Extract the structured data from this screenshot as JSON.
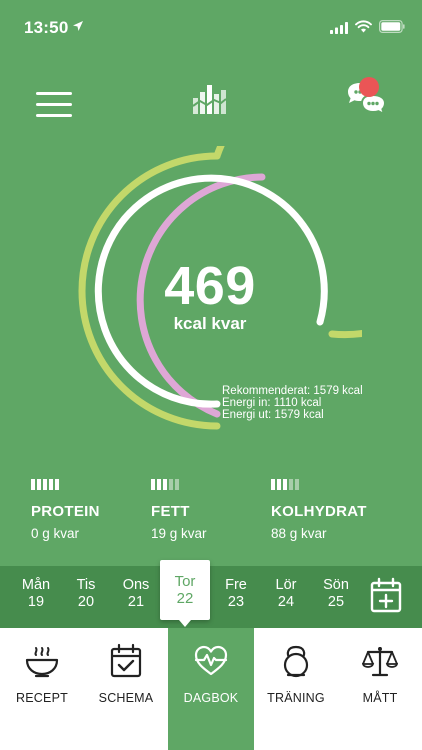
{
  "status_bar": {
    "time": "13:50",
    "icons": [
      "location-arrow-icon",
      "signal-icon",
      "wifi-icon",
      "battery-icon"
    ]
  },
  "header": {
    "menu_icon": "hamburger-menu-icon",
    "logo_icon": "app-logo-icon",
    "chat_icon": "chat-bubbles-icon",
    "has_notification": true
  },
  "summary": {
    "value": "469",
    "unit": "kcal kvar",
    "legend": [
      "Rekommenderat: 1579 kcal",
      "Energi in: 1110 kcal",
      "Energi ut: 1579 kcal"
    ],
    "recommended_kcal": 1579,
    "energy_in_kcal": 1110,
    "energy_out_kcal": 1579,
    "colors": {
      "recommended": "#c3d86a",
      "energy_in": "#dea7d6",
      "energy_out": "#ffffff"
    }
  },
  "macros": [
    {
      "name": "PROTEIN",
      "left": "0 g kvar",
      "bars_filled": 5,
      "bars_total": 5
    },
    {
      "name": "FETT",
      "left": "19 g kvar",
      "bars_filled": 3,
      "bars_total": 5
    },
    {
      "name": "KOLHYDRAT",
      "left": "88 g kvar",
      "bars_filled": 3,
      "bars_total": 5
    }
  ],
  "week": {
    "days": [
      {
        "name": "Mån",
        "date": "19"
      },
      {
        "name": "Tis",
        "date": "20"
      },
      {
        "name": "Ons",
        "date": "21"
      },
      {
        "name": "Tor",
        "date": "22"
      },
      {
        "name": "Fre",
        "date": "23"
      },
      {
        "name": "Lör",
        "date": "24"
      },
      {
        "name": "Sön",
        "date": "25"
      }
    ],
    "selected_index": 3,
    "calendar_icon": "calendar-add-icon"
  },
  "tabs": [
    {
      "label": "RECEPT",
      "icon": "bowl-icon"
    },
    {
      "label": "SCHEMA",
      "icon": "calendar-check-icon"
    },
    {
      "label": "DAGBOK",
      "icon": "heartbeat-icon",
      "active": true
    },
    {
      "label": "TRÄNING",
      "icon": "kettlebell-icon"
    },
    {
      "label": "MÅTT",
      "icon": "scale-icon"
    }
  ],
  "colors": {
    "primary": "#5fa765",
    "week_bar": "#468c4d",
    "tab_bar": "#ffffff"
  }
}
